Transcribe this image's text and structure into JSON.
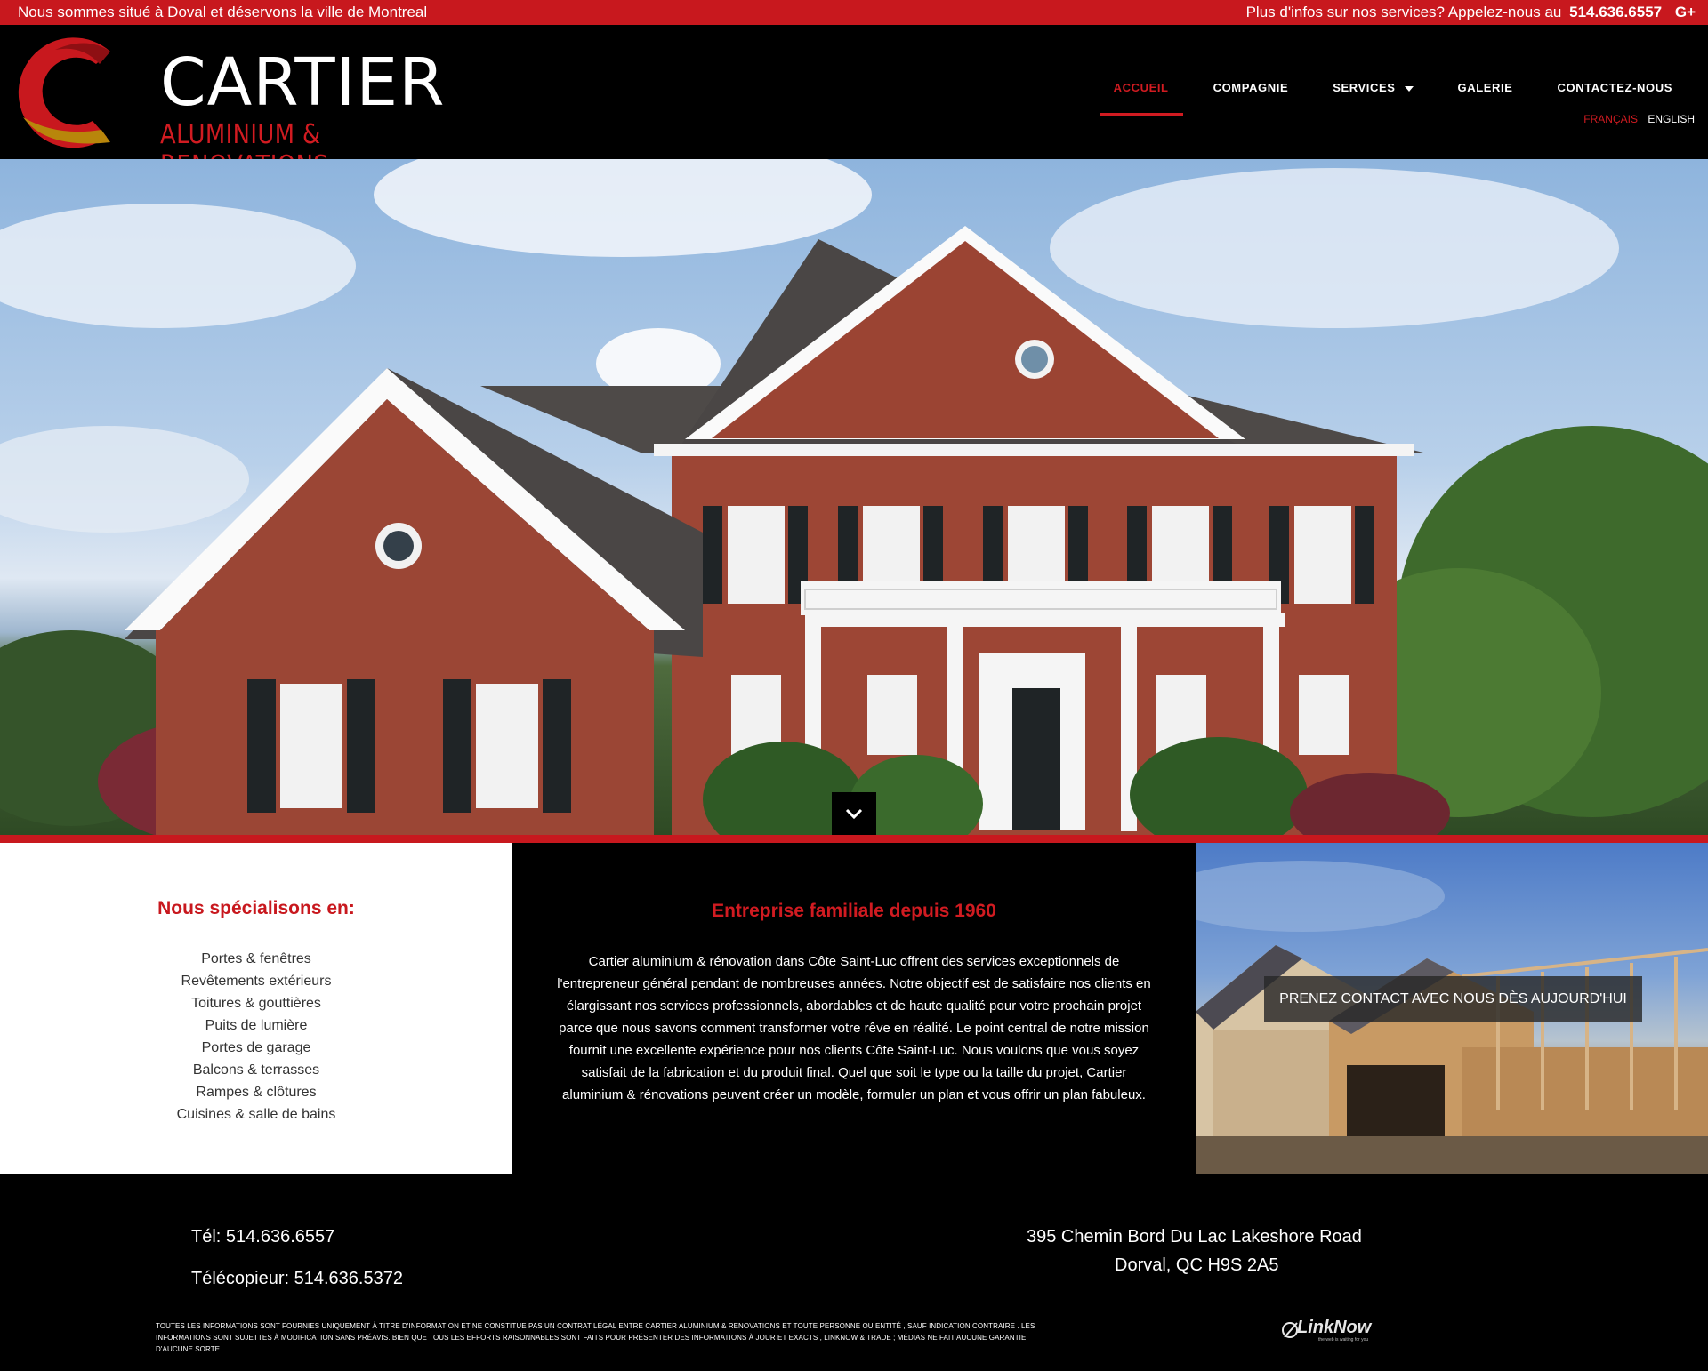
{
  "topbar": {
    "left_text": "Nous sommes situé à Doval et déservons la ville de Montreal",
    "right_text": "Plus d'infos sur nos services? Appelez-nous au",
    "phone": "514.636.6557",
    "social": "G+"
  },
  "logo": {
    "title": "CARTIER",
    "subtitle": "ALUMINIUM & RENOVATIONS"
  },
  "nav": {
    "items": [
      {
        "label": "ACCUEIL",
        "active": true
      },
      {
        "label": "COMPAGNIE",
        "active": false
      },
      {
        "label": "SERVICES",
        "active": false,
        "has_dropdown": true
      },
      {
        "label": "GALERIE",
        "active": false
      },
      {
        "label": "CONTACTEZ-NOUS",
        "active": false
      }
    ],
    "languages": [
      "FRANÇAIS",
      "ENGLISH"
    ]
  },
  "specialties": {
    "title": "Nous spécialisons en:",
    "items": [
      "Portes & fenêtres",
      "Revêtements extérieurs",
      "Toitures & gouttières",
      "Puits de lumière",
      "Portes de garage",
      "Balcons & terrasses",
      "Rampes & clôtures",
      "Cuisines & salle de bains"
    ]
  },
  "about": {
    "title": "Entreprise familiale depuis 1960",
    "body": "Cartier aluminium & rénovation dans Côte Saint-Luc offrent des services exceptionnels de l'entrepreneur général pendant de nombreuses années. Notre objectif est de satisfaire nos clients en élargissant nos services professionnels, abordables et de haute qualité pour votre prochain projet parce que nous savons comment transformer votre rêve en réalité. Le point central de notre mission fournit une excellente expérience pour nos clients Côte Saint-Luc. Nous voulons que vous soyez satisfait de la fabrication et du produit final. Quel que soit le type ou la taille du projet, Cartier aluminium & rénovations peuvent créer un modèle, formuler un plan et vous offrir un plan fabuleux."
  },
  "cta": {
    "label": "PRENEZ CONTACT AVEC NOUS DÈS AUJOURD'HUI"
  },
  "footer": {
    "tel": "Tél: 514.636.6557",
    "fax": "Télécopieur: 514.636.5372",
    "address_line1": "395 Chemin Bord Du Lac Lakeshore Road",
    "address_line2": "Dorval, QC H9S 2A5",
    "legal": "Toutes les informations sont fournies uniquement à titre d'information et ne constitue pas un contrat légal entre Cartier aluminium & renovations et toute personne ou entité , sauf indication contraire . Les informations sont sujettes à modification sans préavis. Bien que tous les efforts raisonnables sont faits pour présenter des informations à jour et exacts , LinkNow & Trade ; Médias ne fait aucune garantie d'aucune sorte.",
    "brand": "LinkNow",
    "brand_tagline": "the web is waiting for you"
  },
  "colors": {
    "accent_red": "#c8181e",
    "logo_gold": "#b8860b"
  },
  "icons": {
    "scroll": "chevron-down-icon",
    "social": "google-plus-icon"
  }
}
